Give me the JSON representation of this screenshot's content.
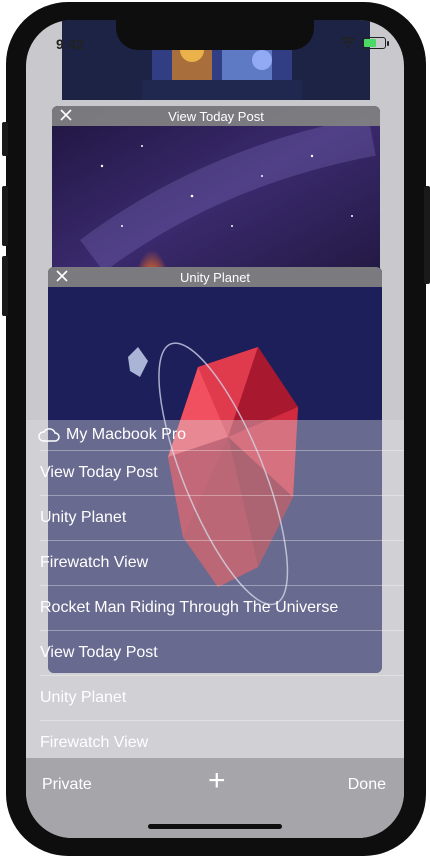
{
  "status_bar": {
    "time": "9:42"
  },
  "cards": [
    {
      "title": ""
    },
    {
      "title": "View Today Post"
    },
    {
      "title": "Unity Planet"
    }
  ],
  "list": {
    "section_title": "My Macbook Pro",
    "items": [
      "View Today Post",
      "Unity Planet",
      "Firewatch View",
      "Rocket Man Riding Through The Universe",
      "View Today Post",
      "Unity Planet",
      "Firewatch View"
    ]
  },
  "toolbar": {
    "private_label": "Private",
    "add_label": "+",
    "done_label": "Done"
  },
  "colors": {
    "status_green": "#4cd964",
    "toolbar_bg": "#a6a6aa",
    "planet_red": "#e53935"
  }
}
